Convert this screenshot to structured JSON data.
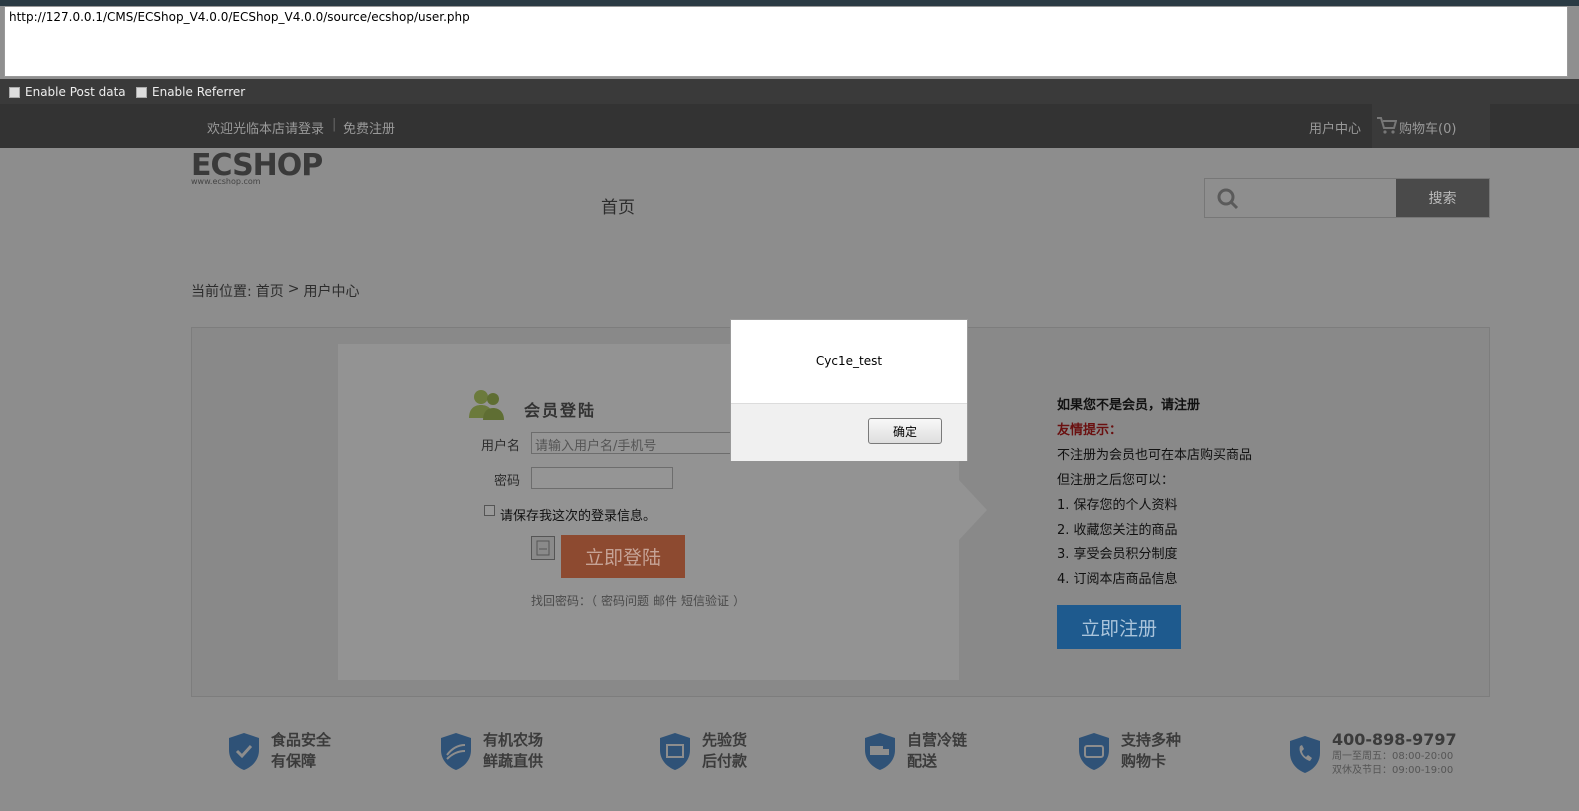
{
  "browser": {
    "url": "http://127.0.0.1/CMS/ECShop_V4.0.0/ECShop_V4.0.0/source/ecshop/user.php",
    "enable_post_label": "Enable Post data",
    "enable_referrer_label": "Enable Referrer"
  },
  "site_header": {
    "welcome_text": "欢迎光临本店请登录",
    "register_link": "免费注册",
    "user_center": "用户中心",
    "cart": "购物车(0)"
  },
  "logo": {
    "text": "ECSHOP",
    "url_text": "www.ecshop.com"
  },
  "nav": {
    "home": "首页"
  },
  "search": {
    "placeholder": "",
    "button": "搜索"
  },
  "breadcrumb": {
    "prefix": "当前位置:",
    "home": "首页",
    "separator": ">",
    "current": "用户中心"
  },
  "login": {
    "title": "会员登陆",
    "username_label": "用户名",
    "username_placeholder": "请输入用户名/手机号",
    "password_label": "密码",
    "remember_label": "请保存我这次的登录信息。",
    "login_button": "立即登陆",
    "forgot_prefix": "找回密码：（",
    "forgot_question": "密码问题",
    "forgot_email": "邮件",
    "forgot_sms": "短信验证",
    "forgot_suffix": "）"
  },
  "register": {
    "heading": "如果您不是会员，请注册",
    "tip_title": "友情提示：",
    "line1": "不注册为会员也可在本店购买商品",
    "line2": "但注册之后您可以：",
    "item1": "1. 保存您的个人资料",
    "item2": "2. 收藏您关注的商品",
    "item3": "3. 享受会员积分制度",
    "item4": "4. 订阅本店商品信息",
    "button": "立即注册"
  },
  "features": [
    {
      "line1": "食品安全",
      "line2": "有保障",
      "icon": "shield-check-icon"
    },
    {
      "line1": "有机农场",
      "line2": "鲜蔬直供",
      "icon": "farm-icon"
    },
    {
      "line1": "先验货",
      "line2": "后付款",
      "icon": "package-icon"
    },
    {
      "line1": "自营冷链",
      "line2": "配送",
      "icon": "truck-icon"
    },
    {
      "line1": "支持多种",
      "line2": "购物卡",
      "icon": "card-icon"
    }
  ],
  "hotline": {
    "number": "400-898-9797",
    "weekday": "周一至周五：08:00-20:00",
    "weekend": "双休及节日：09:00-19:00"
  },
  "dialog": {
    "message": "Cyc1e_test",
    "ok_button": "确定"
  }
}
